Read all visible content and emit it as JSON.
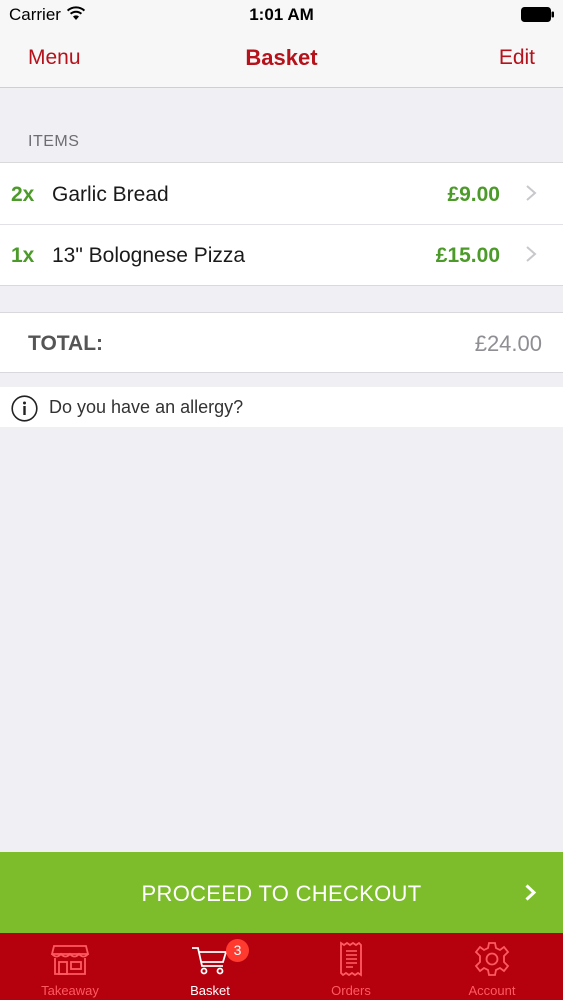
{
  "status_bar": {
    "carrier": "Carrier",
    "time": "1:01 AM"
  },
  "nav": {
    "left_label": "Menu",
    "title": "Basket",
    "right_label": "Edit"
  },
  "section": {
    "header": "ITEMS"
  },
  "items": [
    {
      "qty": "2x",
      "name": "Garlic Bread",
      "price": "£9.00"
    },
    {
      "qty": "1x",
      "name": "13\" Bolognese Pizza",
      "price": "£15.00"
    }
  ],
  "total": {
    "label": "TOTAL:",
    "value": "£24.00"
  },
  "allergy": {
    "text": "Do you have an allergy?",
    "icon": "info-icon"
  },
  "checkout": {
    "label": "PROCEED TO CHECKOUT",
    "icon": "chevron-right-icon"
  },
  "tabs": [
    {
      "label": "Takeaway",
      "icon": "storefront-icon",
      "active": false
    },
    {
      "label": "Basket",
      "icon": "cart-icon",
      "active": true,
      "badge": "3"
    },
    {
      "label": "Orders",
      "icon": "receipt-icon",
      "active": false
    },
    {
      "label": "Account",
      "icon": "gear-icon",
      "active": false
    }
  ],
  "colors": {
    "brand_red": "#b5121b",
    "tab_bar_red": "#b5000e",
    "price_green": "#4c9a2a",
    "checkout_green": "#7dbd2b",
    "badge_red": "#ff3b30"
  }
}
